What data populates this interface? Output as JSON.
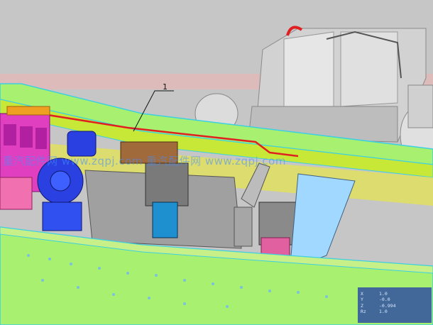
{
  "callout": {
    "label": "1"
  },
  "watermark": {
    "text": "重汽配件网 www.zqpj.com  重汽配件网 www.zqpj.com"
  },
  "coordinate_readout": [
    {
      "axis": "X",
      "value": "1.0"
    },
    {
      "axis": "Y",
      "value": "-0.0"
    },
    {
      "axis": "Z",
      "value": "-0.994"
    },
    {
      "axis": "Rz",
      "value": "1.0"
    }
  ],
  "colors": {
    "background": "#c6c6c6",
    "chassis_rail": "#a8f070",
    "chassis_edge": "#3cd0e0",
    "pipe": "#e02020",
    "transmission": "#909090",
    "pump": "#2a40e0",
    "engine": "#e040c0",
    "crossmember": "#a0d8ff",
    "tank": "#d8d8d8"
  }
}
